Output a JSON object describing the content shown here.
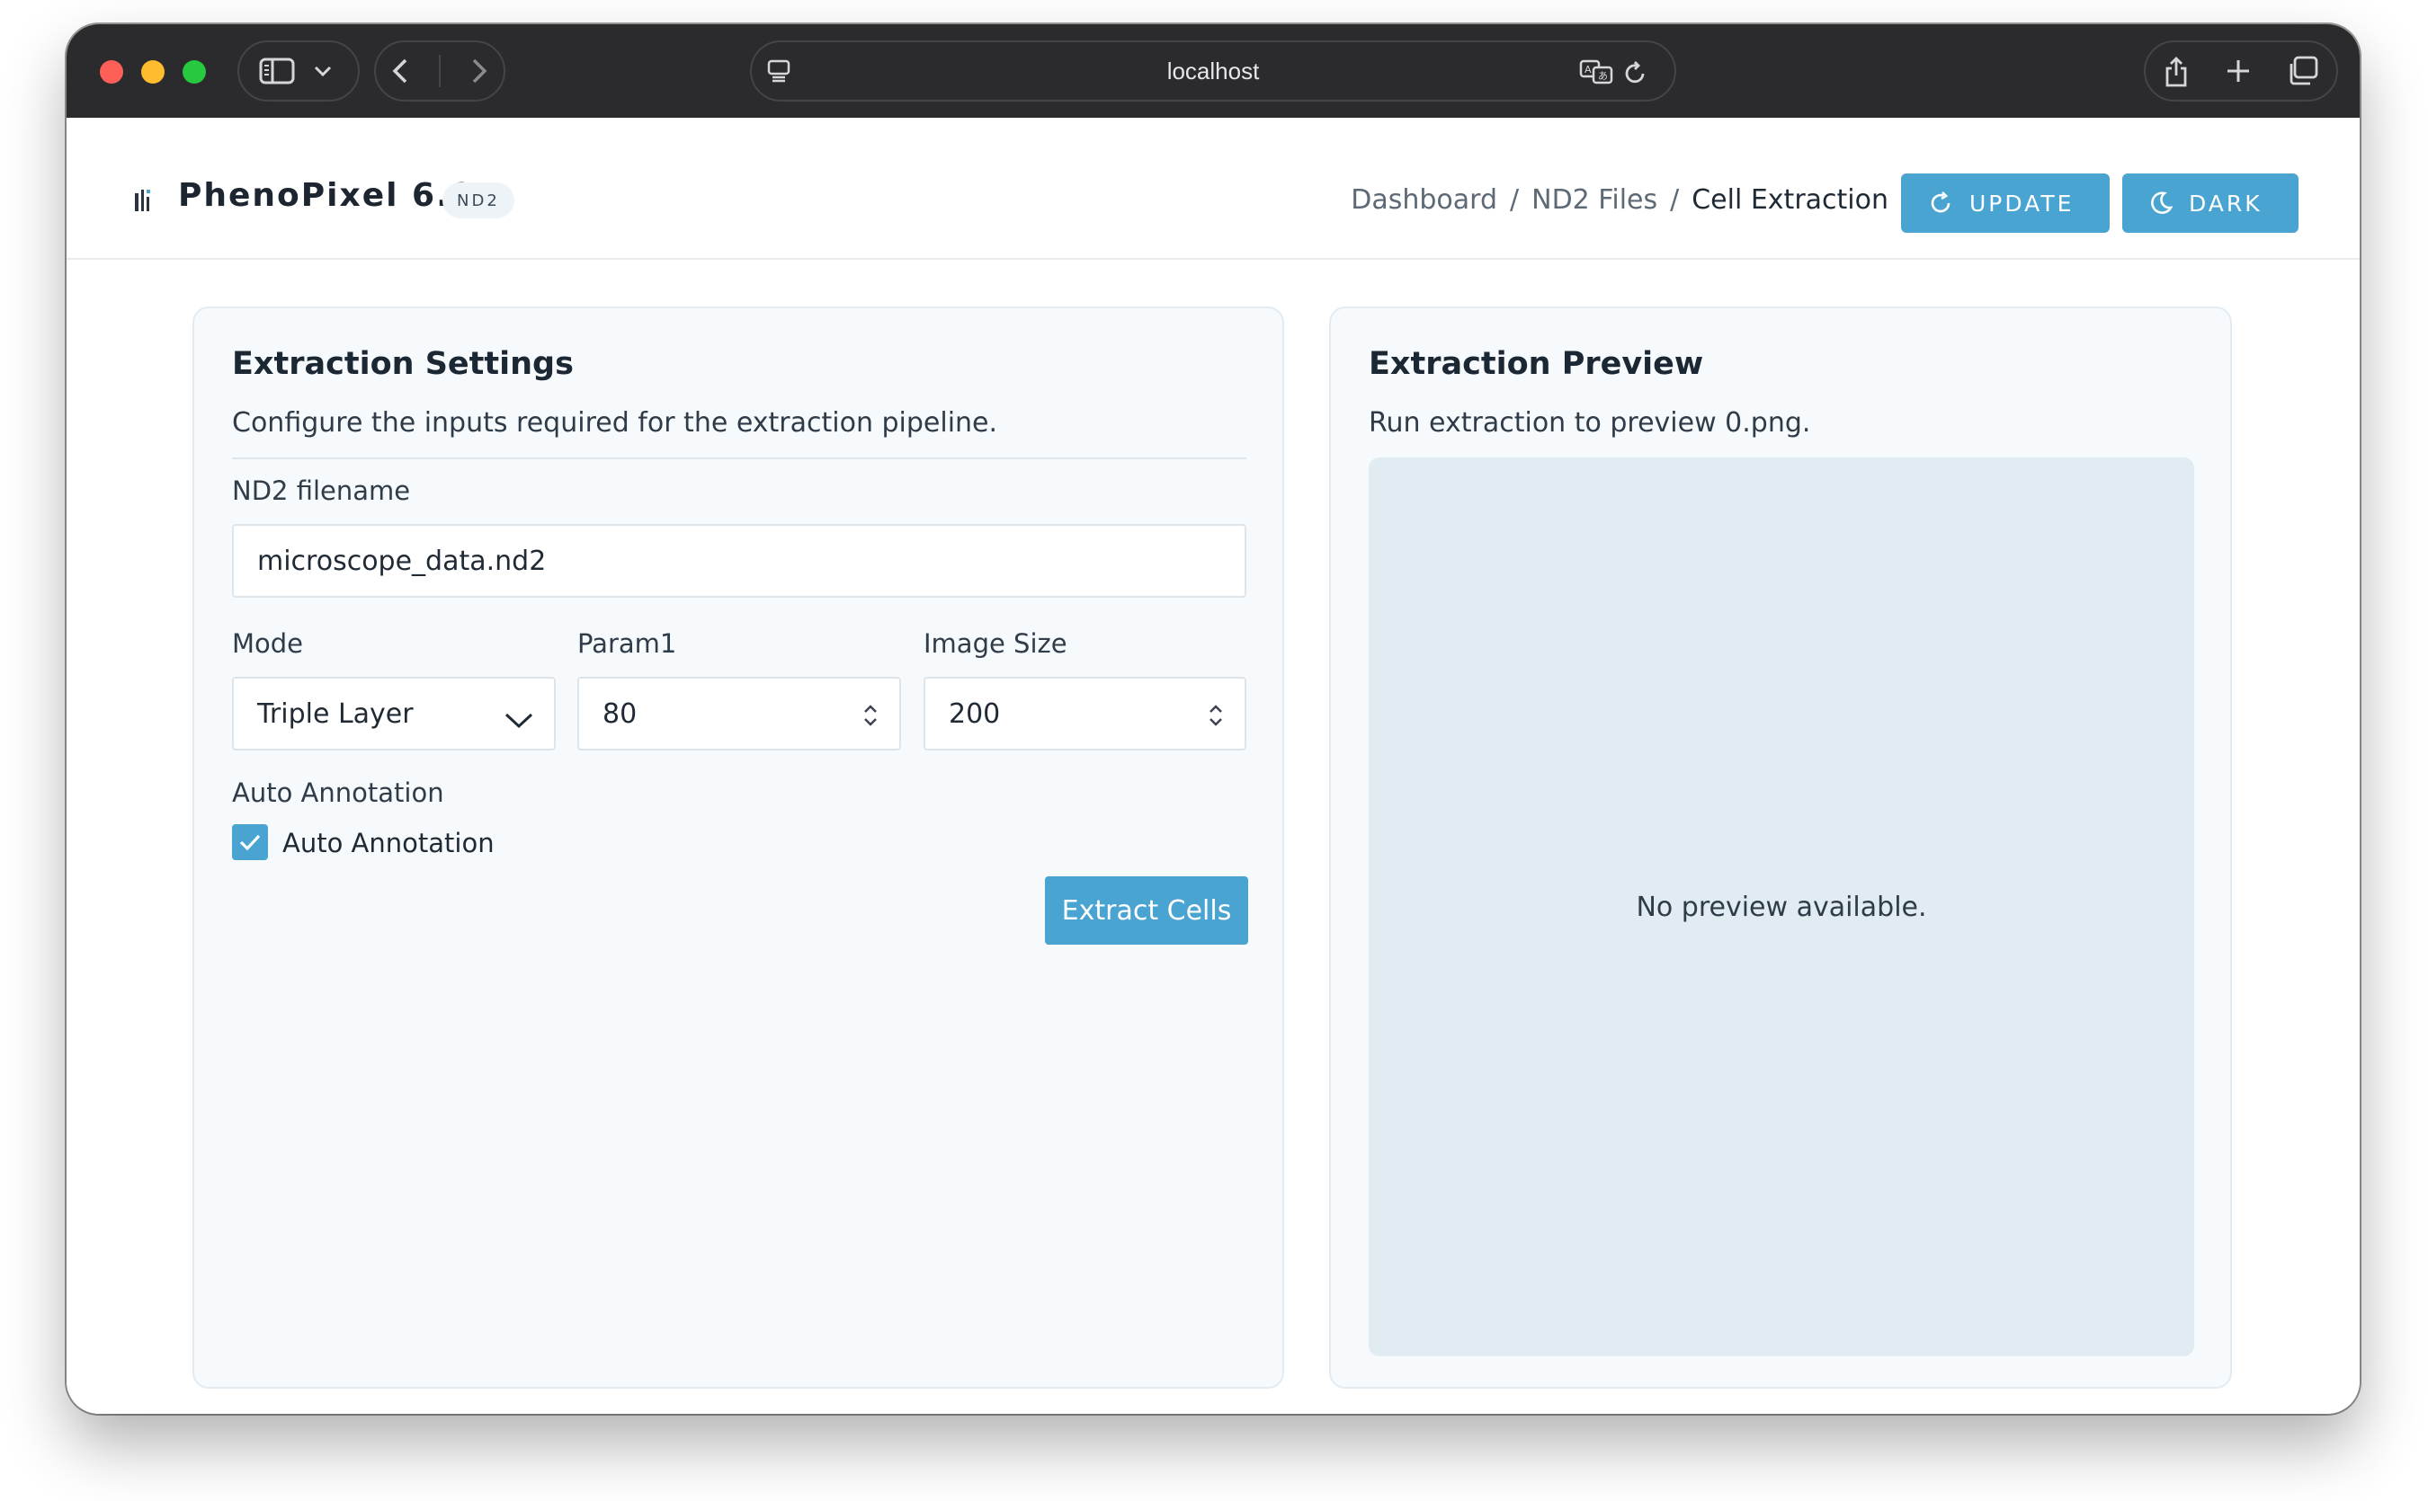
{
  "browser": {
    "address": "localhost"
  },
  "app": {
    "brand_name": "PhenoPixel 6.0",
    "brand_badge": "ND2",
    "breadcrumb": [
      "Dashboard",
      "ND2 Files",
      "Cell Extraction"
    ],
    "update_label": "UPDATE",
    "dark_label": "DARK",
    "accent": "#4aa4d2"
  },
  "settings": {
    "title": "Extraction Settings",
    "subtitle": "Configure the inputs required for the extraction pipeline.",
    "filename_label": "ND2 filename",
    "filename_value": "microscope_data.nd2",
    "mode_label": "Mode",
    "mode_value": "Triple Layer",
    "param1_label": "Param1",
    "param1_value": "80",
    "image_size_label": "Image Size",
    "image_size_value": "200",
    "auto_annotation_label": "Auto Annotation",
    "auto_annotation_checkbox_label": "Auto Annotation",
    "auto_annotation_checked": true,
    "extract_label": "Extract Cells"
  },
  "preview": {
    "title": "Extraction Preview",
    "subtitle": "Run extraction to preview 0.png.",
    "empty_text": "No preview available."
  }
}
